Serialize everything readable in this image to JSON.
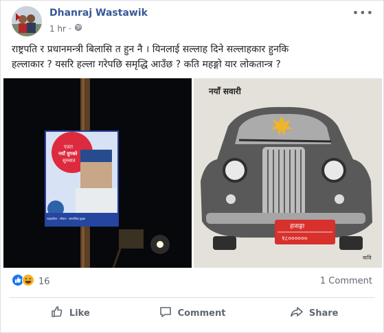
{
  "post": {
    "author": "Dhanraj Wastawik",
    "time": "1 hr",
    "separator": "·",
    "text_line1": "राष्ट्रपति र प्रधानमन्त्री बिलासि त हुन नै । यिनलाई सल्लाह दिने सल्लाहकार हुनकि",
    "text_line2": "हल्लाकार ? यसरि हल्ला गरेपछि समृद्धि आउँछ ? कति महङ्गो यार लोकतान्त्र ?",
    "more_icon": "more-options-icon",
    "privacy_icon": "globe-icon"
  },
  "images": {
    "left": {
      "banner_text1": "एउटा",
      "banner_text2": "नयाँ युगको",
      "banner_text3": "सुरुवात",
      "banner_footer": "सहकारिता - श्रीमान - सामाजिक सुरक्षा"
    },
    "right": {
      "caption": "नयाँ सवारी",
      "plate_line1": "हासङ्गा",
      "plate_line2": "१८००००००",
      "signature": "कवि"
    }
  },
  "engagement": {
    "reaction_count": "16",
    "comment_count": "1 Comment"
  },
  "actions": {
    "like": "Like",
    "comment": "Comment",
    "share": "Share"
  },
  "colors": {
    "author": "#385898",
    "like_blue": "#1877f2",
    "haha_yellow": "#f7b125",
    "muted": "#606770"
  }
}
